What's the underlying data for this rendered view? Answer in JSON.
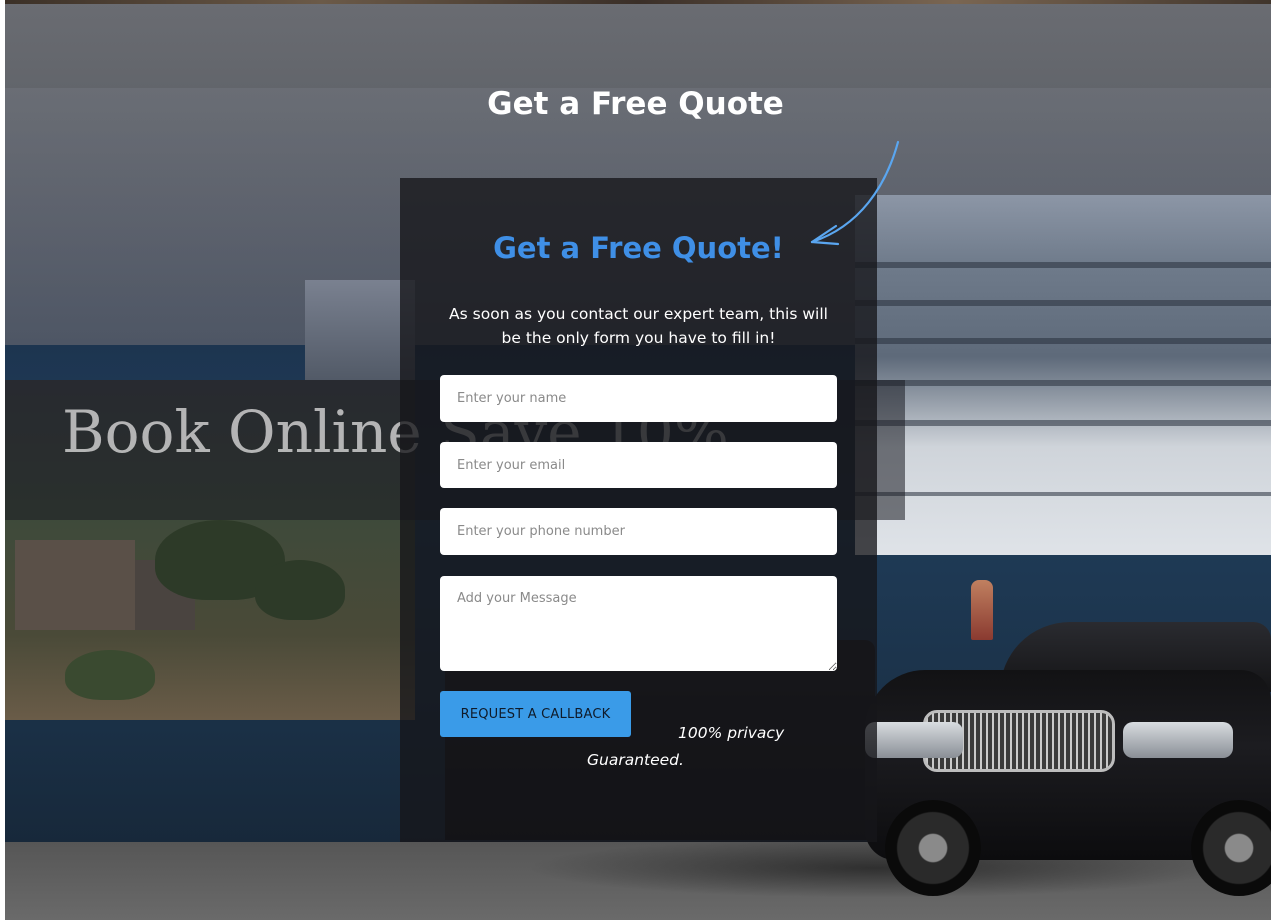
{
  "page": {
    "heading": "Get a Free Quote",
    "background_text": "Book Online Save 10%"
  },
  "form": {
    "title": "Get a Free Quote!",
    "description": "As soon as you contact our expert team, this will be the only form you have to fill in!",
    "fields": {
      "name": {
        "placeholder": "Enter your name",
        "value": ""
      },
      "email": {
        "placeholder": "Enter your email",
        "value": ""
      },
      "phone": {
        "placeholder": "Enter your phone number",
        "value": ""
      },
      "message": {
        "placeholder": "Add your Message",
        "value": ""
      }
    },
    "submit_label": "REQUEST A CALLBACK",
    "privacy_line1": "100% privacy",
    "privacy_line2": "Guaranteed."
  },
  "colors": {
    "accent": "#3f8fe6",
    "button": "#3a9be8",
    "panel": "#16161a"
  },
  "icons": {
    "arrow": "curved-arrow-icon"
  }
}
